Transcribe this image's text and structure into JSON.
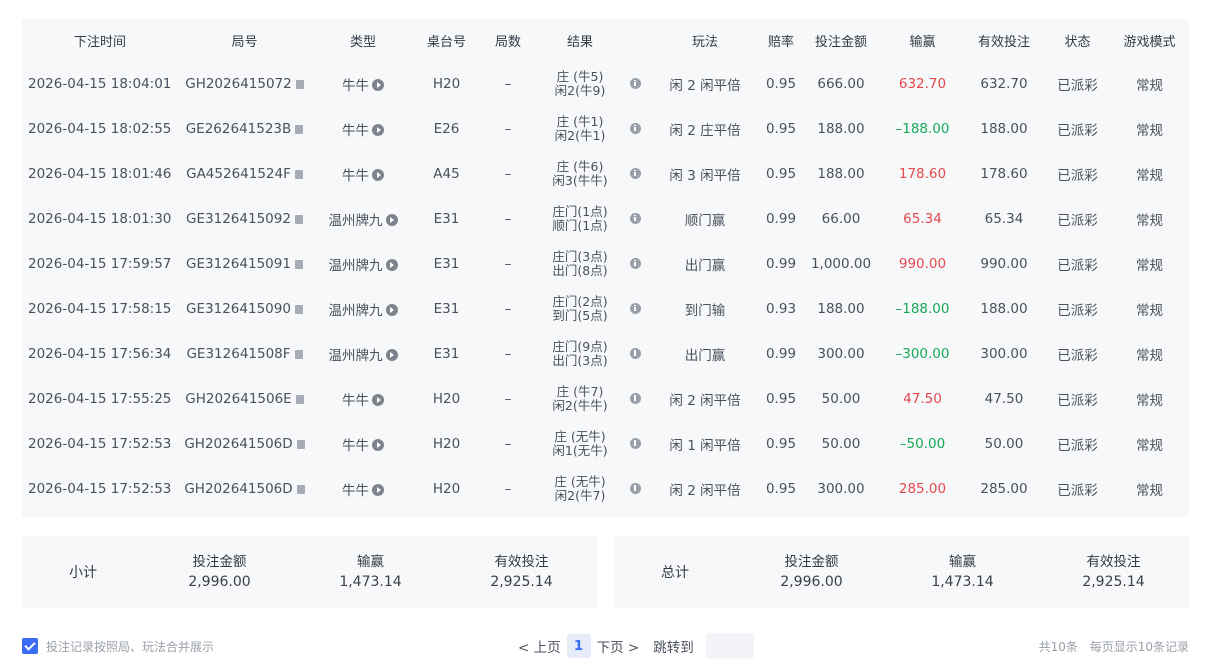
{
  "table": {
    "headers": [
      "下注时间",
      "局号",
      "类型",
      "桌台号",
      "局数",
      "结果",
      "",
      "玩法",
      "赔率",
      "投注金额",
      "输赢",
      "有效投注",
      "状态",
      "游戏模式"
    ],
    "rows": [
      {
        "time": "2026-04-15 18:04:01",
        "round": "GH2026415072",
        "type": "牛牛",
        "table": "H20",
        "count": "–",
        "result1": "庄 (牛5)",
        "result2": "闲2(牛9)",
        "play": "闲 2 闲平倍",
        "odds": "0.95",
        "bet": "666.00",
        "win": "632.70",
        "win_sign": "pos",
        "valid": "632.70",
        "status": "已派彩",
        "mode": "常规"
      },
      {
        "time": "2026-04-15 18:02:55",
        "round": "GE262641523B",
        "type": "牛牛",
        "table": "E26",
        "count": "–",
        "result1": "庄 (牛1)",
        "result2": "闲2(牛1)",
        "play": "闲 2 庄平倍",
        "odds": "0.95",
        "bet": "188.00",
        "win": "–188.00",
        "win_sign": "neg",
        "valid": "188.00",
        "status": "已派彩",
        "mode": "常规"
      },
      {
        "time": "2026-04-15 18:01:46",
        "round": "GA452641524F",
        "type": "牛牛",
        "table": "A45",
        "count": "–",
        "result1": "庄 (牛6)",
        "result2": "闲3(牛牛)",
        "play": "闲 3 闲平倍",
        "odds": "0.95",
        "bet": "188.00",
        "win": "178.60",
        "win_sign": "pos",
        "valid": "178.60",
        "status": "已派彩",
        "mode": "常规"
      },
      {
        "time": "2026-04-15 18:01:30",
        "round": "GE3126415092",
        "type": "温州牌九",
        "table": "E31",
        "count": "–",
        "result1": "庄门(1点)",
        "result2": "顺门(1点)",
        "play": "顺门赢",
        "odds": "0.99",
        "bet": "66.00",
        "win": "65.34",
        "win_sign": "pos",
        "valid": "65.34",
        "status": "已派彩",
        "mode": "常规"
      },
      {
        "time": "2026-04-15 17:59:57",
        "round": "GE3126415091",
        "type": "温州牌九",
        "table": "E31",
        "count": "–",
        "result1": "庄门(3点)",
        "result2": "出门(8点)",
        "play": "出门赢",
        "odds": "0.99",
        "bet": "1,000.00",
        "win": "990.00",
        "win_sign": "pos",
        "valid": "990.00",
        "status": "已派彩",
        "mode": "常规"
      },
      {
        "time": "2026-04-15 17:58:15",
        "round": "GE3126415090",
        "type": "温州牌九",
        "table": "E31",
        "count": "–",
        "result1": "庄门(2点)",
        "result2": "到门(5点)",
        "play": "到门输",
        "odds": "0.93",
        "bet": "188.00",
        "win": "–188.00",
        "win_sign": "neg",
        "valid": "188.00",
        "status": "已派彩",
        "mode": "常规"
      },
      {
        "time": "2026-04-15 17:56:34",
        "round": "GE312641508F",
        "type": "温州牌九",
        "table": "E31",
        "count": "–",
        "result1": "庄门(9点)",
        "result2": "出门(3点)",
        "play": "出门赢",
        "odds": "0.99",
        "bet": "300.00",
        "win": "–300.00",
        "win_sign": "neg",
        "valid": "300.00",
        "status": "已派彩",
        "mode": "常规"
      },
      {
        "time": "2026-04-15 17:55:25",
        "round": "GH202641506E",
        "type": "牛牛",
        "table": "H20",
        "count": "–",
        "result1": "庄 (牛7)",
        "result2": "闲2(牛牛)",
        "play": "闲 2 闲平倍",
        "odds": "0.95",
        "bet": "50.00",
        "win": "47.50",
        "win_sign": "pos",
        "valid": "47.50",
        "status": "已派彩",
        "mode": "常规"
      },
      {
        "time": "2026-04-15 17:52:53",
        "round": "GH202641506D",
        "type": "牛牛",
        "table": "H20",
        "count": "–",
        "result1": "庄 (无牛)",
        "result2": "闲1(无牛)",
        "play": "闲 1 闲平倍",
        "odds": "0.95",
        "bet": "50.00",
        "win": "–50.00",
        "win_sign": "neg",
        "valid": "50.00",
        "status": "已派彩",
        "mode": "常规"
      },
      {
        "time": "2026-04-15 17:52:53",
        "round": "GH202641506D",
        "type": "牛牛",
        "table": "H20",
        "count": "–",
        "result1": "庄 (无牛)",
        "result2": "闲2(牛7)",
        "play": "闲 2 闲平倍",
        "odds": "0.95",
        "bet": "300.00",
        "win": "285.00",
        "win_sign": "pos",
        "valid": "285.00",
        "status": "已派彩",
        "mode": "常规"
      }
    ]
  },
  "subtotal": {
    "title": "小计",
    "bet_label": "投注金额",
    "bet": "2,996.00",
    "win_label": "输赢",
    "win": "1,473.14",
    "valid_label": "有效投注",
    "valid": "2,925.14"
  },
  "total": {
    "title": "总计",
    "bet_label": "投注金额",
    "bet": "2,996.00",
    "win_label": "输赢",
    "win": "1,473.14",
    "valid_label": "有效投注",
    "valid": "2,925.14"
  },
  "footer": {
    "merge_label": "投注记录按照局、玩法合并展示",
    "merge_checked": true,
    "prev_label": "< 上页",
    "current_page": "1",
    "next_label": "下页 >",
    "jump_label": "跳转到",
    "jump_value": "",
    "total_records": "共10条",
    "per_page": "每页显示10条记录"
  },
  "colors": {
    "win": "#e5484d",
    "loss": "#18a957",
    "accent": "#3b6cf5"
  },
  "icons": {
    "round_copy": "copy-icon",
    "type_play": "play-icon",
    "result_info": "info-icon",
    "merge": "checkbox-checked-icon"
  }
}
